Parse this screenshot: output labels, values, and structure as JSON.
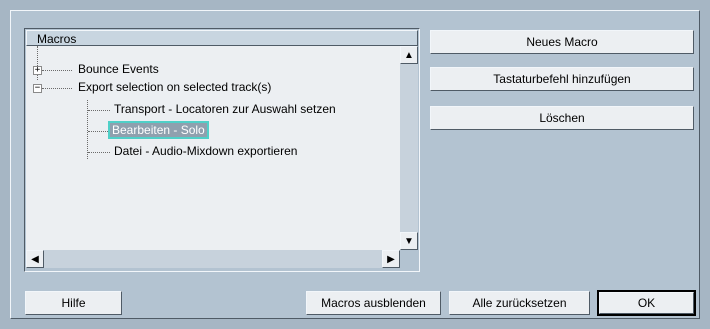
{
  "macros_panel": {
    "header": "Macros",
    "tree": [
      {
        "label": "Bounce Events",
        "expander": "+"
      },
      {
        "label": "Export selection on selected track(s)",
        "expander": "−"
      },
      {
        "label": "Transport - Locatoren zur Auswahl setzen"
      },
      {
        "label": "Bearbeiten - Solo",
        "selected": true
      },
      {
        "label": "Datei - Audio-Mixdown exportieren"
      }
    ]
  },
  "scrollbar_icons": {
    "up": "▲",
    "down": "▼",
    "left": "◀",
    "right": "▶"
  },
  "right_buttons": {
    "new_macro": "Neues Macro",
    "add_shortcut": "Tastaturbefehl hinzufügen",
    "delete": "Löschen"
  },
  "bottom_buttons": {
    "help": "Hilfe",
    "hide_macros": "Macros ausblenden",
    "reset_all": "Alle zurücksetzen",
    "ok": "OK"
  }
}
